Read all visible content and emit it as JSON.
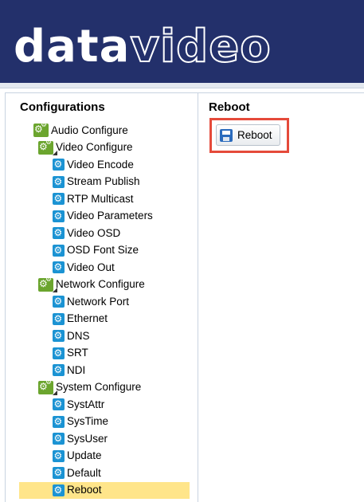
{
  "header": {
    "logo_bold": "data",
    "logo_light": "video"
  },
  "left_panel": {
    "title": "Configurations",
    "tree": [
      {
        "label": "Audio Configure",
        "level": 1,
        "type": "group",
        "expanded": false
      },
      {
        "label": "Video Configure",
        "level": 1,
        "type": "group",
        "expanded": true
      },
      {
        "label": "Video Encode",
        "level": 2,
        "type": "item"
      },
      {
        "label": "Stream Publish",
        "level": 2,
        "type": "item"
      },
      {
        "label": "RTP Multicast",
        "level": 2,
        "type": "item"
      },
      {
        "label": "Video Parameters",
        "level": 2,
        "type": "item"
      },
      {
        "label": "Video OSD",
        "level": 2,
        "type": "item"
      },
      {
        "label": "OSD Font Size",
        "level": 2,
        "type": "item"
      },
      {
        "label": "Video Out",
        "level": 2,
        "type": "item"
      },
      {
        "label": "Network Configure",
        "level": 1,
        "type": "group",
        "expanded": true
      },
      {
        "label": "Network Port",
        "level": 2,
        "type": "item"
      },
      {
        "label": "Ethernet",
        "level": 2,
        "type": "item"
      },
      {
        "label": "DNS",
        "level": 2,
        "type": "item"
      },
      {
        "label": "SRT",
        "level": 2,
        "type": "item"
      },
      {
        "label": "NDI",
        "level": 2,
        "type": "item"
      },
      {
        "label": "System Configure",
        "level": 1,
        "type": "group",
        "expanded": true
      },
      {
        "label": "SystAttr",
        "level": 2,
        "type": "item"
      },
      {
        "label": "SysTime",
        "level": 2,
        "type": "item"
      },
      {
        "label": "SysUser",
        "level": 2,
        "type": "item"
      },
      {
        "label": "Update",
        "level": 2,
        "type": "item"
      },
      {
        "label": "Default",
        "level": 2,
        "type": "item"
      },
      {
        "label": "Reboot",
        "level": 2,
        "type": "item",
        "selected": true
      }
    ]
  },
  "right_panel": {
    "title": "Reboot",
    "reboot_button_label": "Reboot"
  },
  "colors": {
    "header_bg": "#23306b",
    "selected_bg": "#ffe58a",
    "highlight_border": "#e54a3a",
    "group_icon": "#6ba52e",
    "item_icon": "#1b93d3"
  }
}
